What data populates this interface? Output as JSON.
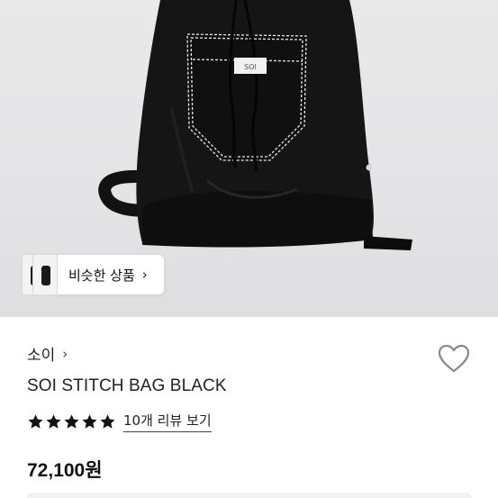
{
  "similar": {
    "label": "비슷한 상품",
    "chevron": "›"
  },
  "product_image": {
    "label_text": "SOI",
    "bag_color": "#141414",
    "stitch_color": "#e8e8e8"
  },
  "brand": {
    "name": "소이",
    "chevron": "›"
  },
  "favorite": {
    "icon": "heart-outline-icon"
  },
  "title": "SOI STITCH BAG BLACK",
  "rating": {
    "stars": 5,
    "review_link": "10개 리뷰 보기"
  },
  "price": "72,100원"
}
